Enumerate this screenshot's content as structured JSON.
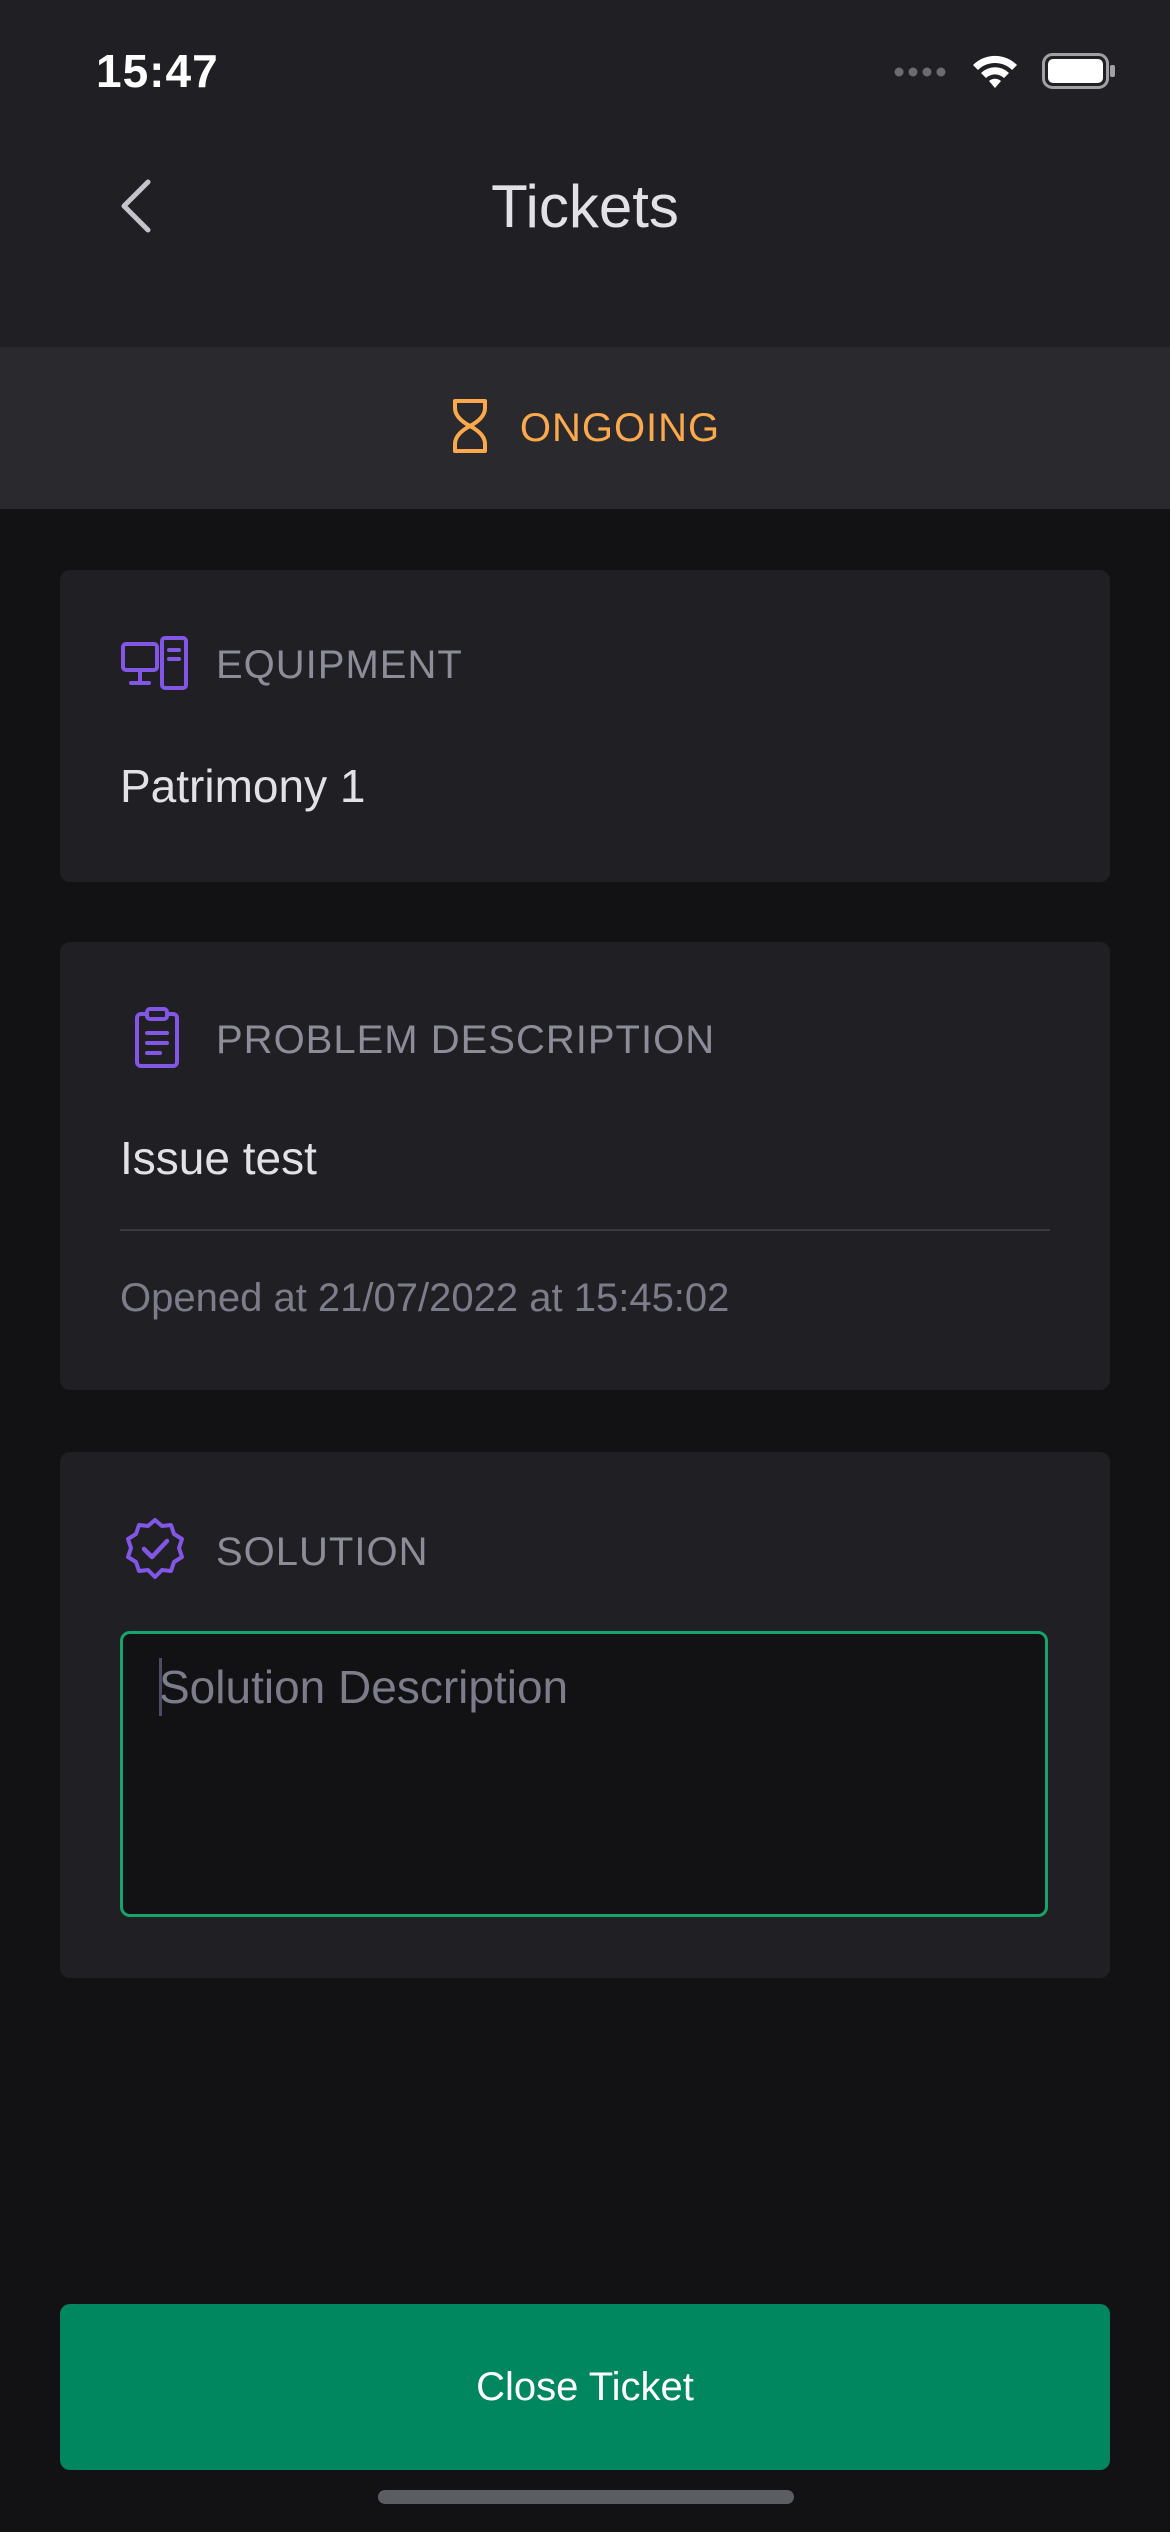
{
  "status_bar": {
    "time": "15:47"
  },
  "header": {
    "title": "Tickets"
  },
  "ticket_status": {
    "label": "ONGOING",
    "icon": "hourglass-icon",
    "color": "#FBA94C"
  },
  "equipment": {
    "label": "EQUIPMENT",
    "icon": "desktop-tower-icon",
    "value": "Patrimony 1"
  },
  "problem": {
    "label": "PROBLEM DESCRIPTION",
    "icon": "clipboard-icon",
    "value": "Issue test",
    "opened_at": "Opened at 21/07/2022 at 15:45:02"
  },
  "solution": {
    "label": "SOLUTION",
    "icon": "check-badge-icon",
    "placeholder": "Solution Description",
    "value": ""
  },
  "actions": {
    "close_ticket": "Close Ticket"
  },
  "colors": {
    "accent_purple": "#8257E5",
    "status_orange": "#FBA94C",
    "primary_green": "#00875F",
    "input_border": "#17A36B"
  }
}
